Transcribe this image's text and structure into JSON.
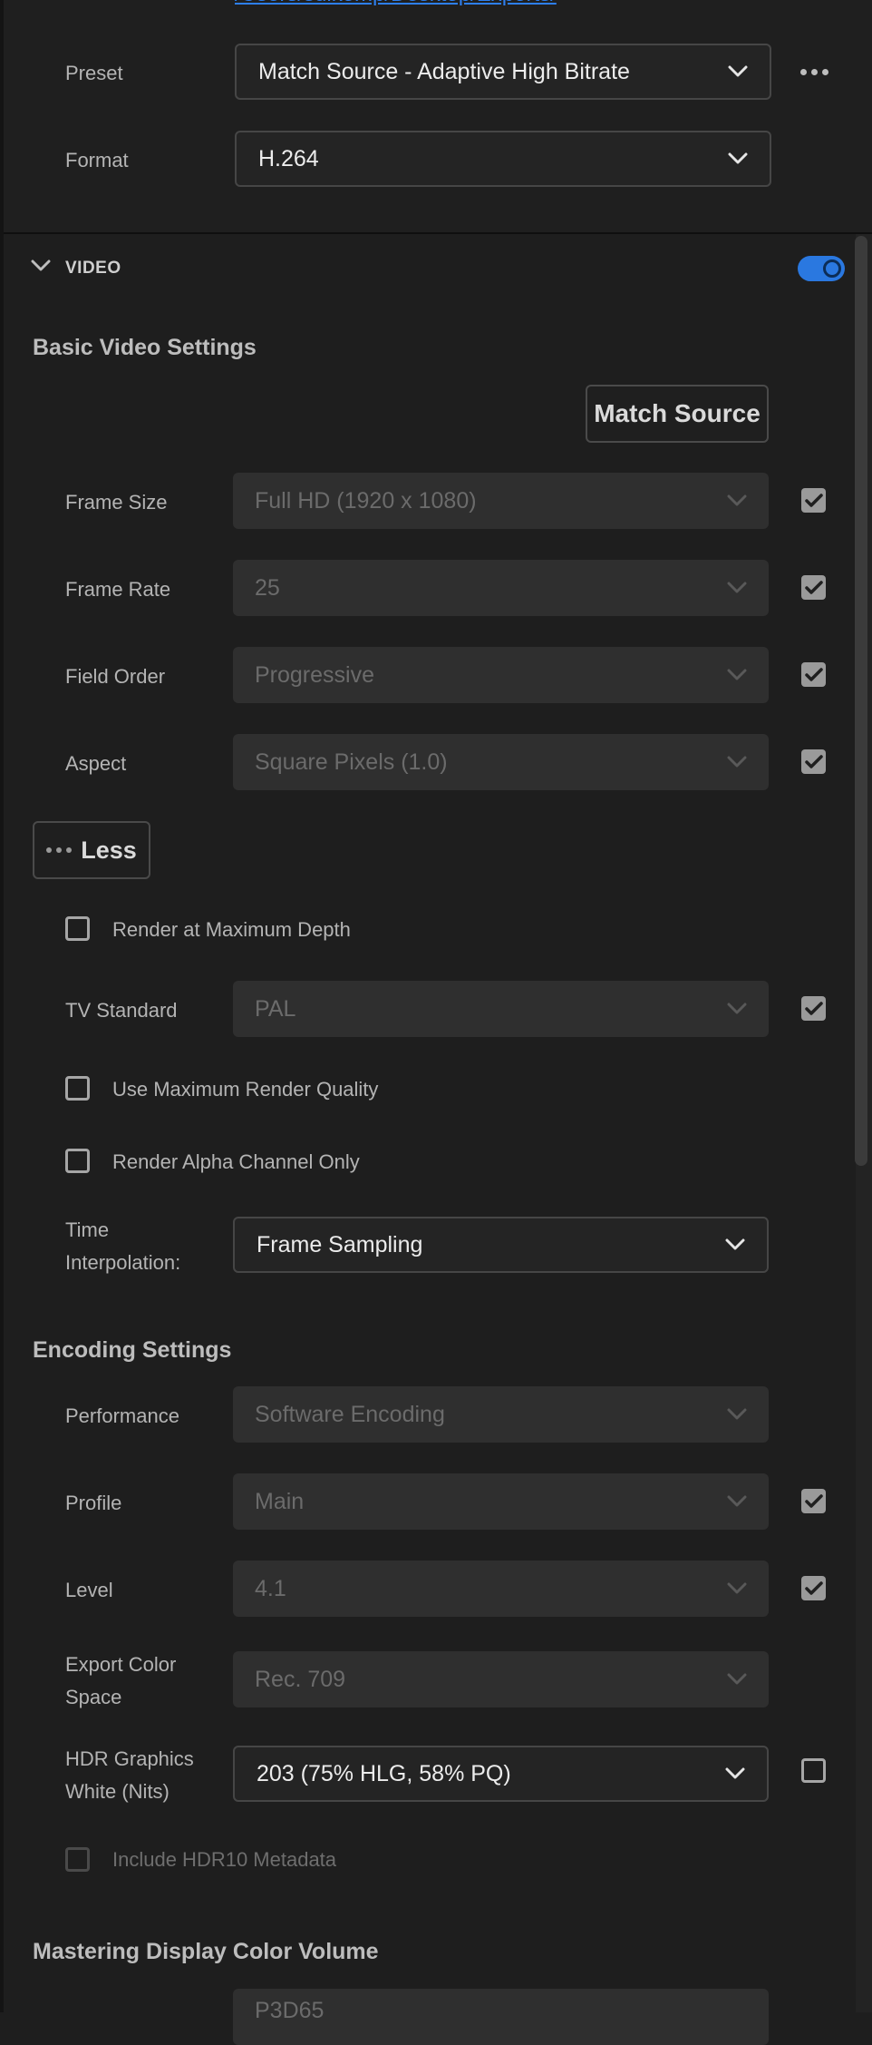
{
  "output": {
    "location_value": "/Users/sulkomp/Desktop/Exports/",
    "preset_label": "Preset",
    "preset_value": "Match Source - Adaptive High Bitrate",
    "format_label": "Format",
    "format_value": "H.264"
  },
  "video": {
    "header": "VIDEO",
    "enabled": true,
    "basic_title": "Basic Video Settings",
    "match_source_label": "Match Source",
    "frame_size_label": "Frame Size",
    "frame_size_value": "Full HD (1920 x 1080)",
    "frame_rate_label": "Frame Rate",
    "frame_rate_value": "25",
    "field_order_label": "Field Order",
    "field_order_value": "Progressive",
    "aspect_label": "Aspect",
    "aspect_value": "Square Pixels (1.0)",
    "less_label": "Less",
    "render_max_depth_label": "Render at Maximum Depth",
    "tv_standard_label": "TV Standard",
    "tv_standard_value": "PAL",
    "max_render_quality_label": "Use Maximum Render Quality",
    "alpha_only_label": "Render Alpha Channel Only",
    "time_interp_label_line1": "Time",
    "time_interp_label_line2": "Interpolation:",
    "time_interp_value": "Frame Sampling"
  },
  "encoding": {
    "title": "Encoding Settings",
    "performance_label": "Performance",
    "performance_value": "Software Encoding",
    "profile_label": "Profile",
    "profile_value": "Main",
    "level_label": "Level",
    "level_value": "4.1",
    "color_space_label_line1": "Export Color",
    "color_space_label_line2": "Space",
    "color_space_value": "Rec. 709",
    "hdr_white_label_line1": "HDR Graphics",
    "hdr_white_label_line2": "White (Nits)",
    "hdr_white_value": "203 (75% HLG, 58% PQ)",
    "hdr10_label": "Include HDR10 Metadata"
  },
  "mastering": {
    "title": "Mastering Display Color Volume",
    "first_value": "P3D65"
  },
  "colors": {
    "accent": "#2a78e0",
    "background": "#1e1e1e",
    "link": "#2d7ff0"
  }
}
